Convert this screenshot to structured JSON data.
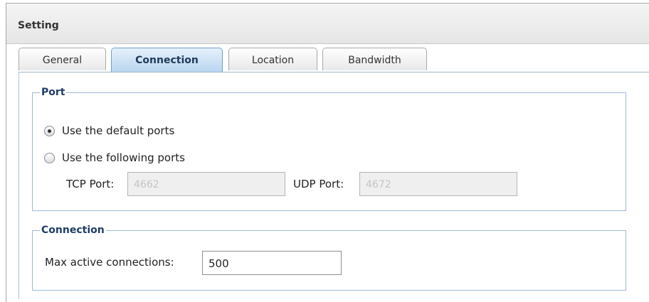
{
  "window": {
    "title": "Setting"
  },
  "tabs": [
    {
      "label": "General"
    },
    {
      "label": "Connection"
    },
    {
      "label": "Location"
    },
    {
      "label": "Bandwidth"
    }
  ],
  "active_tab": "Connection",
  "port": {
    "legend": "Port",
    "option_default": "Use the default ports",
    "option_custom": "Use the following ports",
    "selected": "default",
    "tcp_label": "TCP Port:",
    "tcp_value": "4662",
    "udp_label": "UDP Port:",
    "udp_value": "4672"
  },
  "connection": {
    "legend": "Connection",
    "max_label": "Max active connections:",
    "max_value": "500"
  }
}
